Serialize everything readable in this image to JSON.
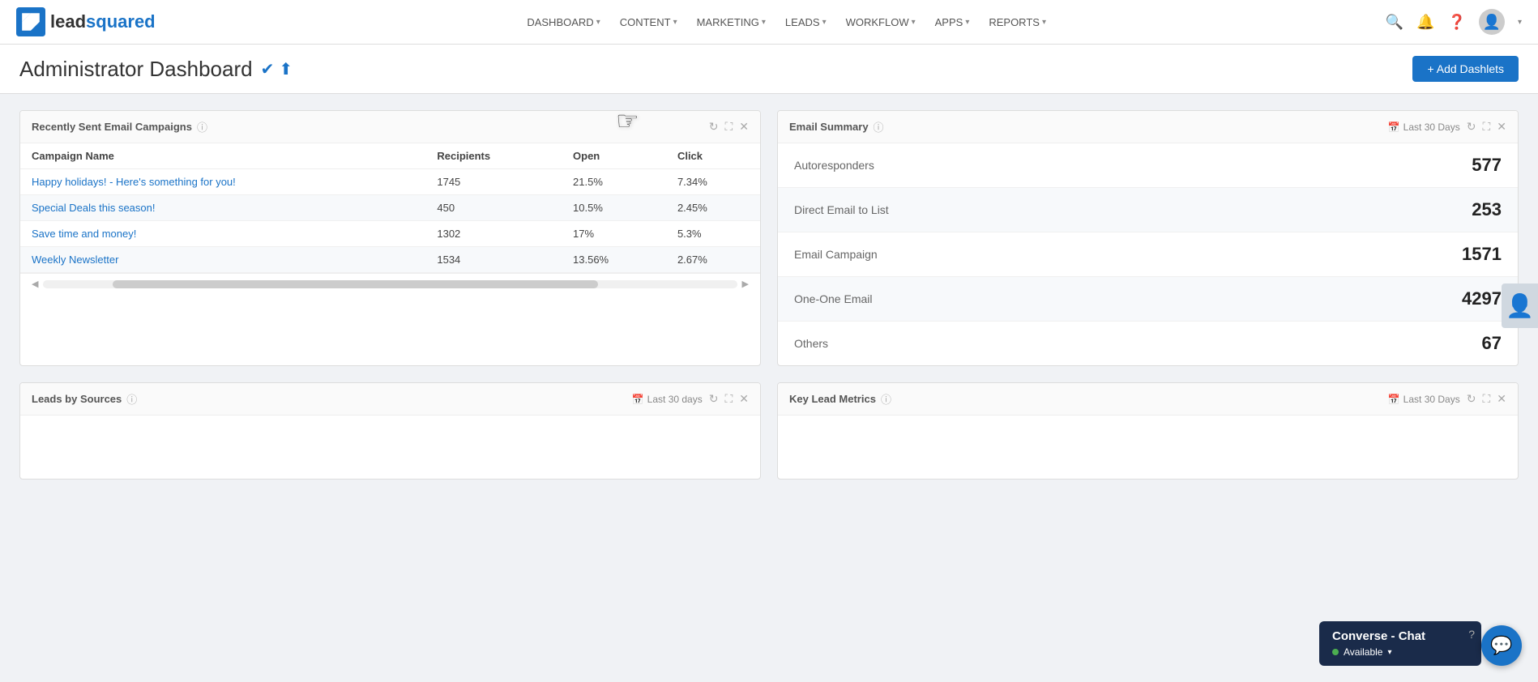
{
  "nav": {
    "logo_lead": "lead",
    "logo_squared": "squared",
    "items": [
      {
        "label": "DASHBOARD",
        "id": "dashboard"
      },
      {
        "label": "CONTENT",
        "id": "content"
      },
      {
        "label": "MARKETING",
        "id": "marketing"
      },
      {
        "label": "LEADS",
        "id": "leads"
      },
      {
        "label": "WORKFLOW",
        "id": "workflow"
      },
      {
        "label": "APPS",
        "id": "apps"
      },
      {
        "label": "REPORTS",
        "id": "reports"
      }
    ]
  },
  "page": {
    "title": "Administrator Dashboard",
    "add_dashlets_label": "+ Add Dashlets"
  },
  "campaigns_dashlet": {
    "title": "Recently Sent Email Campaigns",
    "columns": {
      "name": "Campaign Name",
      "recipients": "Recipients",
      "open": "Open",
      "click": "Click"
    },
    "rows": [
      {
        "name": "Happy holidays! - Here's something for you!",
        "recipients": "1745",
        "open": "21.5%",
        "click": "7.34%"
      },
      {
        "name": "Special Deals this season!",
        "recipients": "450",
        "open": "10.5%",
        "click": "2.45%"
      },
      {
        "name": "Save time and money!",
        "recipients": "1302",
        "open": "17%",
        "click": "5.3%"
      },
      {
        "name": "Weekly Newsletter",
        "recipients": "1534",
        "open": "13.56%",
        "click": "2.67%"
      }
    ]
  },
  "email_summary_dashlet": {
    "title": "Email Summary",
    "date_range": "Last 30 Days",
    "rows": [
      {
        "label": "Autoresponders",
        "value": "577"
      },
      {
        "label": "Direct Email to List",
        "value": "253"
      },
      {
        "label": "Email Campaign",
        "value": "1571"
      },
      {
        "label": "One-One Email",
        "value": "4297"
      },
      {
        "label": "Others",
        "value": "67"
      }
    ]
  },
  "leads_by_sources": {
    "title": "Leads by Sources",
    "date_range": "Last 30 days"
  },
  "key_lead_metrics": {
    "title": "Key Lead Metrics",
    "date_range": "Last 30 Days"
  },
  "converse": {
    "title": "Converse - Chat",
    "status": "Available",
    "help_label": "?"
  }
}
